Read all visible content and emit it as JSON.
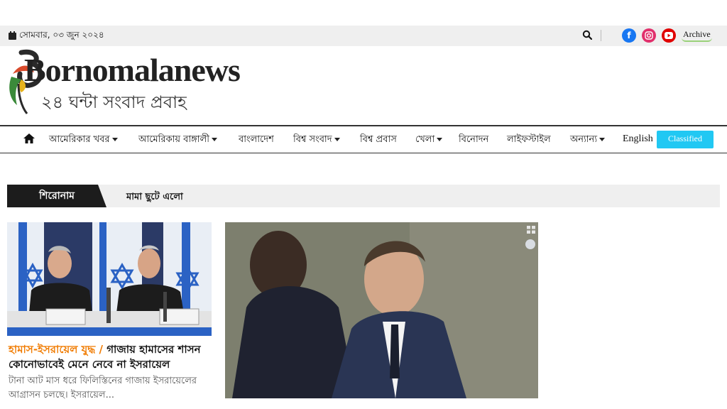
{
  "topbar": {
    "date": "সোমবার, ০৩ জুন ২০২৪",
    "archive_label": "Archive"
  },
  "logo": {
    "name": "Bornomalanews",
    "tagline": "২৪ ঘন্টা সংবাদ প্রবাহ"
  },
  "nav": {
    "items": [
      {
        "label": "আমেরিকার খবর",
        "dropdown": true
      },
      {
        "label": "আমেরিকায় বাঙ্গালী",
        "dropdown": true
      },
      {
        "label": "বাংলাদেশ",
        "dropdown": false
      },
      {
        "label": "বিশ্ব সংবাদ",
        "dropdown": true
      },
      {
        "label": "বিশ্ব প্রবাস",
        "dropdown": false
      },
      {
        "label": "খেলা",
        "dropdown": true
      },
      {
        "label": "বিনোদন",
        "dropdown": false
      },
      {
        "label": "লাইফস্টাইল",
        "dropdown": false
      },
      {
        "label": "অন্যান্য",
        "dropdown": true
      }
    ],
    "english_label": "English",
    "classified_label": "Classified"
  },
  "ticker": {
    "label": "শিরোনাম",
    "text": "মামা ছুটে এলো"
  },
  "articles": {
    "first": {
      "category": "হামাস-ইসরায়েল যুদ্ধ /",
      "title": "গাজায় হামাসের শাসন কোনোভাবেই মেনে নেবে না ইসরায়েল",
      "summary": "টানা আট মাস ধরে ফিলিস্তিনের গাজায় ইসরায়েলের আগ্রাসন চলছে। ইসরায়েল..."
    }
  },
  "colors": {
    "accent": "#21c8f3",
    "category": "#f07b00",
    "facebook": "#1877f2",
    "instagram": "#e1306c",
    "youtube": "#e00000"
  }
}
